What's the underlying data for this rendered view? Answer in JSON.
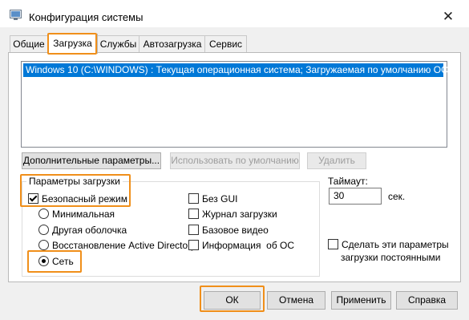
{
  "window": {
    "title": "Конфигурация системы",
    "close_glyph": "✕"
  },
  "tabs": [
    {
      "label": "Общие",
      "active": false
    },
    {
      "label": "Загрузка",
      "active": true
    },
    {
      "label": "Службы",
      "active": false
    },
    {
      "label": "Автозагрузка",
      "active": false
    },
    {
      "label": "Сервис",
      "active": false
    }
  ],
  "boot_list": [
    "Windows 10 (C:\\WINDOWS) : Текущая операционная система; Загружаемая по умолчанию ОС"
  ],
  "buttons": {
    "advanced": "Дополнительные параметры...",
    "set_default": "Использовать по умолчанию",
    "delete": "Удалить"
  },
  "boot_options": {
    "title": "Параметры загрузки",
    "safe_boot": {
      "label": "Безопасный режим",
      "checked": true
    },
    "minimal": {
      "label": "Минимальная",
      "selected": false
    },
    "alternate_shell": {
      "label": "Другая оболочка",
      "selected": false
    },
    "ad_repair": {
      "label": "Восстановление Active Directory",
      "selected": false
    },
    "network": {
      "label": "Сеть",
      "selected": true
    },
    "no_gui": {
      "label": "Без GUI",
      "checked": false
    },
    "boot_log": {
      "label": "Журнал загрузки",
      "checked": false
    },
    "base_video": {
      "label": "Базовое видео",
      "checked": false
    },
    "os_info": {
      "label": "Информация  об ОС",
      "checked": false
    }
  },
  "timeout": {
    "label": "Таймаут:",
    "value": "30",
    "unit": "сек."
  },
  "make_permanent": {
    "line1": "Сделать эти параметры",
    "line2": "загрузки постоянными",
    "checked": false
  },
  "footer": {
    "ok": "ОК",
    "cancel": "Отмена",
    "apply": "Применить",
    "help": "Справка"
  },
  "colors": {
    "highlight": "#f08f1a",
    "selection": "#0078d7"
  }
}
